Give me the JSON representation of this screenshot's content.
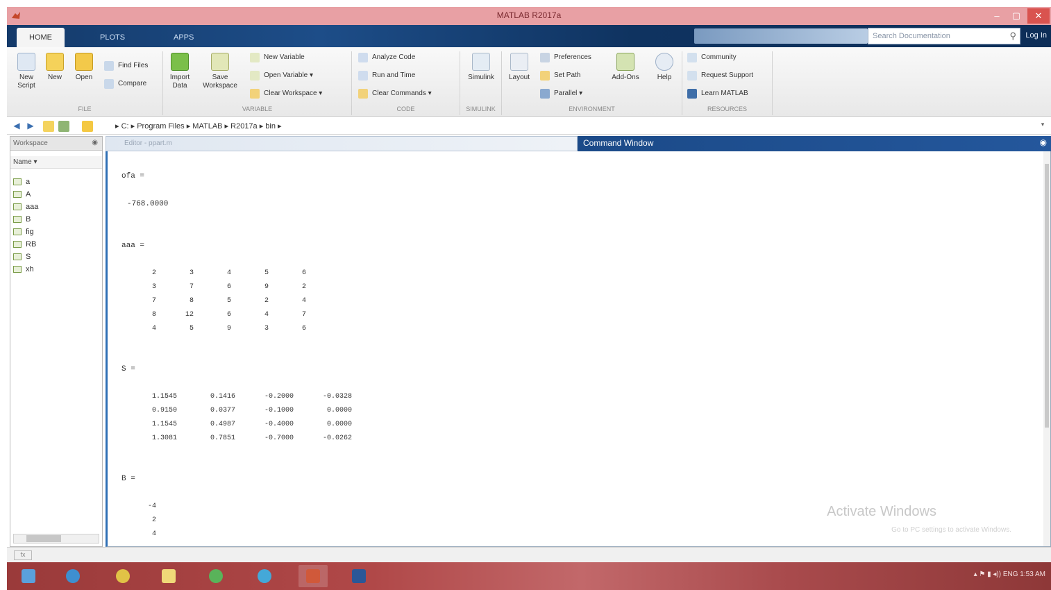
{
  "window": {
    "title": "MATLAB R2017a",
    "minimize": "–",
    "maximize": "▢",
    "close": "✕"
  },
  "tabs": [
    {
      "label": "HOME",
      "active": true
    },
    {
      "label": "PLOTS",
      "active": false
    },
    {
      "label": "APPS",
      "active": false
    }
  ],
  "search": {
    "placeholder": "Search Documentation"
  },
  "login_label": "Log In",
  "ribbon": {
    "new_script": "New Script",
    "new": "New",
    "open": "Open",
    "find_files": "Find Files",
    "compare": "Compare",
    "import_data": "Import Data",
    "save_workspace": "Save Workspace",
    "new_variable": "New Variable",
    "open_variable": "Open Variable ▾",
    "clear_workspace": "Clear Workspace ▾",
    "analyze_code": "Analyze Code",
    "run_and_time": "Run and Time",
    "clear_commands": "Clear Commands ▾",
    "simulink": "Simulink",
    "layout": "Layout",
    "preferences": "Preferences",
    "set_path": "Set Path",
    "parallel": "Parallel ▾",
    "add_ons": "Add-Ons",
    "help": "Help",
    "community": "Community",
    "request_support": "Request Support",
    "learn_matlab": "Learn MATLAB",
    "sections": [
      "FILE",
      "VARIABLE",
      "CODE",
      "SIMULINK",
      "ENVIRONMENT",
      "RESOURCES"
    ]
  },
  "address": {
    "path": "▸ C: ▸ Program Files ▸ MATLAB ▸ R2017a ▸ bin ▸"
  },
  "workspace": {
    "title": "Workspace",
    "column": "Name ▾",
    "variables": [
      "a",
      "A",
      "aaa",
      "B",
      "fig",
      "RB",
      "S",
      "xh"
    ]
  },
  "editor_tab": "Editor - ppart.m",
  "command_window": {
    "title": "Command Window",
    "var1_label": "ofa =",
    "var1_value": "-768.0000",
    "var2_label": "aaa =",
    "var2_rows": [
      [
        "2",
        "3",
        "4",
        "5",
        "6"
      ],
      [
        "3",
        "7",
        "6",
        "9",
        "2"
      ],
      [
        "7",
        "8",
        "5",
        "2",
        "4"
      ],
      [
        "8",
        "12",
        "6",
        "4",
        "7"
      ],
      [
        "4",
        "5",
        "9",
        "3",
        "6"
      ]
    ],
    "var3_label": "S =",
    "var3_rows": [
      [
        "1.1545",
        "0.1416",
        "-0.2000",
        "-0.0328"
      ],
      [
        "0.9150",
        "0.0377",
        "-0.1000",
        "0.0000"
      ],
      [
        "1.1545",
        "0.4987",
        "-0.4000",
        "0.0000"
      ],
      [
        "1.3081",
        "0.7851",
        "-0.7000",
        "-0.0262"
      ]
    ],
    "var4_label": "B =",
    "var4_values": [
      "-4",
      "2",
      "4"
    ],
    "watermark_title": "Activate Windows",
    "watermark_sub": "Go to PC settings to activate Windows."
  },
  "status": {
    "text": "fx"
  },
  "taskbar": {
    "tray_text": "▴  ⚑  ▮  ◂))  ENG  ",
    "clock": "1:53 AM"
  },
  "colors": {
    "title_bar": "#e8a0a4",
    "tab_strip": "#1d4d88",
    "command_header": "#24579c",
    "taskbar": "#b04848"
  }
}
